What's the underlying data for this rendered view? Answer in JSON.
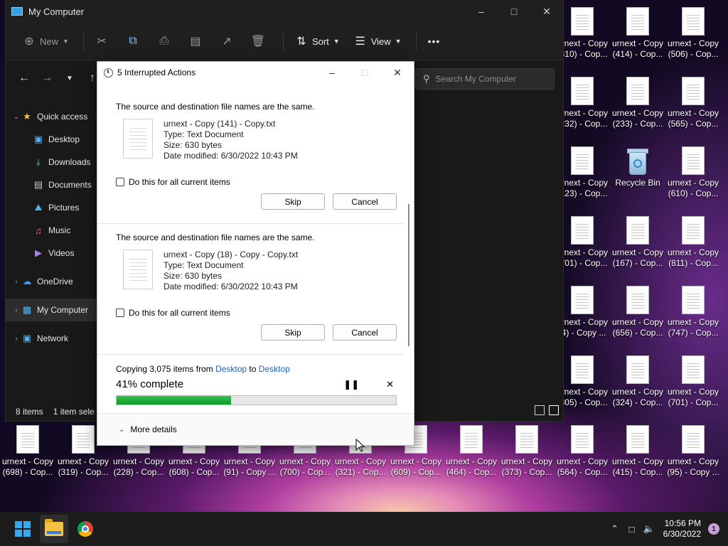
{
  "desktop": {
    "right_icons": [
      {
        "l1": "urnext - Copy",
        "l2": "(810) - Cop..."
      },
      {
        "l1": "urnext - Copy",
        "l2": "(414) - Cop..."
      },
      {
        "l1": "urnext - Copy",
        "l2": "(506) - Cop..."
      },
      {
        "l1": "urnext - Copy",
        "l2": "(232) - Cop..."
      },
      {
        "l1": "urnext - Copy",
        "l2": "(233) - Cop..."
      },
      {
        "l1": "urnext - Copy",
        "l2": "(565) - Cop..."
      },
      {
        "l1": "urnext - Copy",
        "l2": "(123) - Cop..."
      },
      {
        "l1": "Recycle Bin",
        "l2": ""
      },
      {
        "l1": "urnext - Copy",
        "l2": "(610) - Cop..."
      },
      {
        "l1": "urnext - Copy",
        "l2": "(701) - Cop..."
      },
      {
        "l1": "urnext - Copy",
        "l2": "(167) - Cop..."
      },
      {
        "l1": "urnext - Copy",
        "l2": "(811) - Cop..."
      },
      {
        "l1": "urnext - Copy",
        "l2": "(4) - Copy ..."
      },
      {
        "l1": "urnext - Copy",
        "l2": "(656) - Cop..."
      },
      {
        "l1": "urnext - Copy",
        "l2": "(747) - Cop..."
      },
      {
        "l1": "urnext - Copy",
        "l2": "(305) - Cop..."
      },
      {
        "l1": "urnext - Copy",
        "l2": "(324) - Cop..."
      },
      {
        "l1": "urnext - Copy",
        "l2": "(701) - Cop..."
      }
    ],
    "bottom_icons": [
      {
        "l1": "urnext - Copy",
        "l2": "(698) - Cop..."
      },
      {
        "l1": "urnext - Copy",
        "l2": "(319) - Cop..."
      },
      {
        "l1": "urnext - Copy",
        "l2": "(228) - Cop..."
      },
      {
        "l1": "urnext - Copy",
        "l2": "(608) - Cop..."
      },
      {
        "l1": "urnext - Copy",
        "l2": "(91) - Copy ..."
      },
      {
        "l1": "urnext - Copy",
        "l2": "(700) - Cop..."
      },
      {
        "l1": "urnext - Copy",
        "l2": "(321) - Cop..."
      },
      {
        "l1": "urnext - Copy",
        "l2": "(609) - Cop..."
      },
      {
        "l1": "urnext - Copy",
        "l2": "(464) - Cop..."
      },
      {
        "l1": "urnext - Copy",
        "l2": "(373) - Cop..."
      },
      {
        "l1": "urnext - Copy",
        "l2": "(564) - Cop..."
      },
      {
        "l1": "urnext - Copy",
        "l2": "(415) - Cop..."
      },
      {
        "l1": "urnext - Copy",
        "l2": "(95) - Copy ..."
      }
    ]
  },
  "explorer": {
    "title": "My Computer",
    "toolbar": {
      "new_label": "New",
      "sort_label": "Sort",
      "view_label": "View",
      "more_label": "•••"
    },
    "search_placeholder": "Search My Computer",
    "sidebar": {
      "quick_access": "Quick access",
      "desktop": "Desktop",
      "downloads": "Downloads",
      "documents": "Documents",
      "pictures": "Pictures",
      "music": "Music",
      "videos": "Videos",
      "onedrive": "OneDrive",
      "my_computer": "My Computer",
      "network": "Network"
    },
    "status": {
      "items": "8 items",
      "selected": "1 item sele"
    }
  },
  "dialog": {
    "title": "5 Interrupted Actions",
    "conflicts": [
      {
        "headline": "The source and destination file names are the same.",
        "file_name": "urnext - Copy (141) - Copy.txt",
        "type": "Type: Text Document",
        "size": "Size: 630 bytes",
        "modified": "Date modified: 6/30/2022 10:43 PM",
        "checkbox_label": "Do this for all current items",
        "skip_label": "Skip",
        "cancel_label": "Cancel"
      },
      {
        "headline": "The source and destination file names are the same.",
        "file_name": "urnext - Copy (18) - Copy - Copy.txt",
        "type": "Type: Text Document",
        "size": "Size: 630 bytes",
        "modified": "Date modified: 6/30/2022 10:43 PM",
        "checkbox_label": "Do this for all current items",
        "skip_label": "Skip",
        "cancel_label": "Cancel"
      }
    ],
    "progress": {
      "prefix": "Copying 3,075 items from ",
      "from": "Desktop",
      "middle": " to ",
      "to": "Desktop",
      "percent_label": "41% complete",
      "fraction": 0.41
    },
    "more_details_label": "More details"
  },
  "taskbar": {
    "time": "10:56 PM",
    "date": "6/30/2022",
    "notification_count": "1"
  }
}
